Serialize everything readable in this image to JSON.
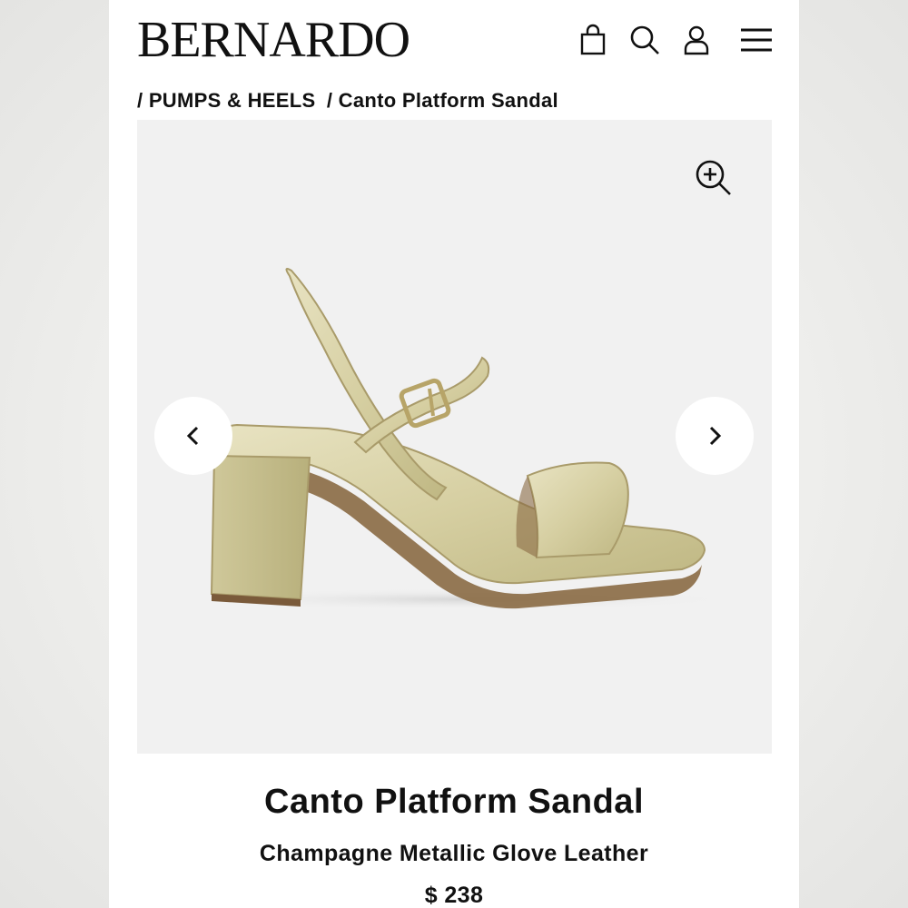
{
  "header": {
    "logo": "BERNARDO",
    "icons": [
      "bag-icon",
      "search-icon",
      "user-icon",
      "menu-icon"
    ]
  },
  "breadcrumb": {
    "items": [
      "/ PUMPS & HEELS",
      "/ Canto Platform Sandal"
    ]
  },
  "gallery": {
    "icons": [
      "zoom-in-icon",
      "chevron-left-icon",
      "chevron-right-icon"
    ],
    "image_alt": "Canto Platform Sandal"
  },
  "product": {
    "title": "Canto Platform Sandal",
    "color_material": "Champagne Metallic Glove Leather",
    "price": "$ 238"
  },
  "colors": {
    "accent": "#111111",
    "gallery_bg": "#f1f1f1",
    "shoe_gold": "#d9d2a6"
  }
}
